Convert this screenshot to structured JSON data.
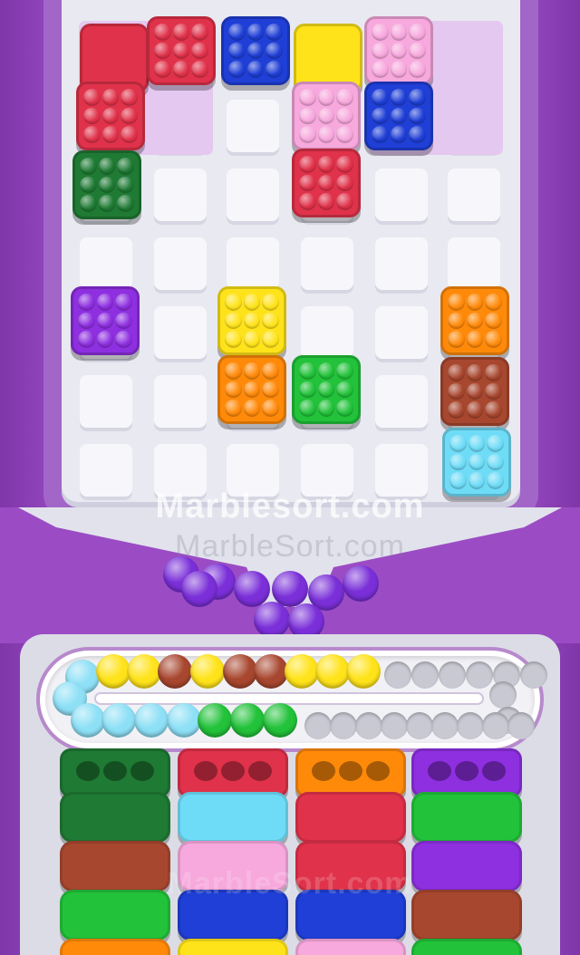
{
  "watermarks": {
    "top_bold": "Marblesort.com",
    "top_light": "MarbleSort.com",
    "bottom_faded": "MarbleSort.com"
  },
  "colors": {
    "red": "#e0324a",
    "blue": "#1f3fd6",
    "yellow": "#ffe31a",
    "pink": "#f7a8dd",
    "dark_green": "#1f7a34",
    "purple": "#8e2fe0",
    "orange": "#ff8a0a",
    "green": "#22c23a",
    "brown": "#a8472f",
    "cyan": "#6fdcf7",
    "marble_purple": "#7a2fd8",
    "light_blue": "#8ee0f6"
  },
  "board": {
    "containers": [
      {
        "name": "left-container",
        "color": "striped-blue"
      },
      {
        "name": "right-container",
        "color": "striped-blue"
      }
    ],
    "blocks": [
      {
        "name": "red-flat",
        "color": "red",
        "style": "flat"
      },
      {
        "name": "red-top",
        "color": "red"
      },
      {
        "name": "red-lower",
        "color": "red"
      },
      {
        "name": "blue-top",
        "color": "blue"
      },
      {
        "name": "yellow-flat",
        "color": "yellow",
        "style": "flat"
      },
      {
        "name": "pink-top",
        "color": "pink"
      },
      {
        "name": "pink-middle",
        "color": "pink"
      },
      {
        "name": "blue-in-right-container",
        "color": "blue"
      },
      {
        "name": "red-middle",
        "color": "red"
      },
      {
        "name": "dark-green",
        "color": "dark_green"
      },
      {
        "name": "purple",
        "color": "purple"
      },
      {
        "name": "yellow",
        "color": "yellow"
      },
      {
        "name": "orange-left",
        "color": "orange"
      },
      {
        "name": "green",
        "color": "green"
      },
      {
        "name": "orange-right",
        "color": "orange"
      },
      {
        "name": "brown",
        "color": "brown"
      },
      {
        "name": "cyan",
        "color": "cyan"
      }
    ]
  },
  "funnel_marbles": {
    "color": "marble_purple",
    "count": 9
  },
  "conveyor": {
    "top_row": [
      "light_blue",
      "yellow",
      "yellow",
      "brown",
      "yellow",
      "brown",
      "brown",
      "yellow",
      "yellow",
      "yellow"
    ],
    "bottom_row": [
      "light_blue",
      "light_blue",
      "light_blue",
      "light_blue",
      "light_blue",
      "green",
      "green",
      "green"
    ],
    "empty_slots": 17
  },
  "columns": [
    {
      "cap_color": "dark_green",
      "trays": [
        "dark_green",
        "brown",
        "green",
        "orange"
      ]
    },
    {
      "cap_color": "red",
      "trays": [
        "cyan",
        "pink",
        "blue",
        "yellow"
      ]
    },
    {
      "cap_color": "orange",
      "trays": [
        "red",
        "red",
        "blue",
        "pink"
      ]
    },
    {
      "cap_color": "purple",
      "trays": [
        "green",
        "purple",
        "brown",
        "green"
      ]
    }
  ]
}
